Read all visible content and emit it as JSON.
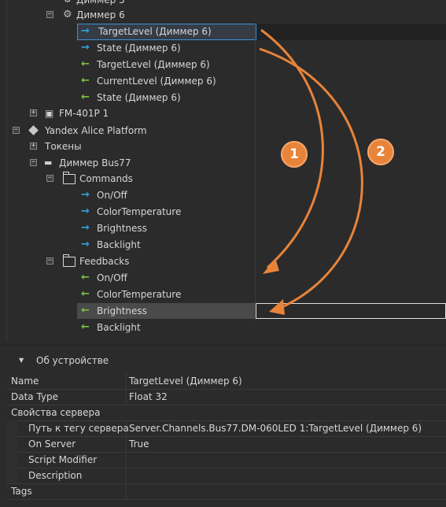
{
  "tree": {
    "rows": [
      {
        "label": "Диммер 5",
        "icon": "gear-icon"
      },
      {
        "label": "Диммер 6",
        "icon": "gear-icon",
        "expander": "−"
      },
      {
        "label": "TargetLevel (Диммер 6)",
        "icon": "arrow-right-icon"
      },
      {
        "label": "State (Диммер 6)",
        "icon": "arrow-right-icon"
      },
      {
        "label": "TargetLevel (Диммер 6)",
        "icon": "arrow-left-icon"
      },
      {
        "label": "CurrentLevel (Диммер 6)",
        "icon": "arrow-left-icon"
      },
      {
        "label": "State (Диммер 6)",
        "icon": "arrow-left-icon"
      },
      {
        "label": "FM-401P 1",
        "icon": "device-icon",
        "expander": "+"
      },
      {
        "label": "Yandex Alice Platform",
        "icon": "diamond-icon",
        "expander": "−"
      },
      {
        "label": "Токены",
        "expander": "+"
      },
      {
        "label": "Диммер Bus77",
        "icon": "device-icon",
        "expander": "−"
      },
      {
        "label": "Commands",
        "icon": "folder-icon",
        "expander": "−"
      },
      {
        "label": "On/Off",
        "icon": "arrow-right-icon"
      },
      {
        "label": "ColorTemperature",
        "icon": "arrow-right-icon"
      },
      {
        "label": "Brightness",
        "icon": "arrow-right-icon"
      },
      {
        "label": "Backlight",
        "icon": "arrow-right-icon"
      },
      {
        "label": "Feedbacks",
        "icon": "folder-icon",
        "expander": "−"
      },
      {
        "label": "On/Off",
        "icon": "arrow-left-icon"
      },
      {
        "label": "ColorTemperature",
        "icon": "arrow-left-icon"
      },
      {
        "label": "Brightness",
        "icon": "arrow-left-icon"
      },
      {
        "label": "Backlight",
        "icon": "arrow-left-icon"
      }
    ]
  },
  "annotations": {
    "badge1": "1",
    "badge2": "2",
    "color": "#e8843a"
  },
  "panel": {
    "title": "Об устройстве",
    "rows": [
      {
        "key": "Name",
        "value": "TargetLevel (Диммер 6)"
      },
      {
        "key": "Data Type",
        "value": "Float 32"
      },
      {
        "key": "Свойства сервера",
        "value": ""
      },
      {
        "key": "Путь к тегу сервера",
        "value": "Server.Channels.Bus77.DM-060LED 1:TargetLevel (Диммер 6)"
      },
      {
        "key": "On Server",
        "value": "True"
      },
      {
        "key": "Script Modifier",
        "value": ""
      },
      {
        "key": "Description",
        "value": ""
      },
      {
        "key": "Tags",
        "value": ""
      }
    ]
  },
  "colors": {
    "input_arrow": "#2fa3e0",
    "output_arrow": "#7cc142",
    "selection_border": "#3c8fd8"
  }
}
